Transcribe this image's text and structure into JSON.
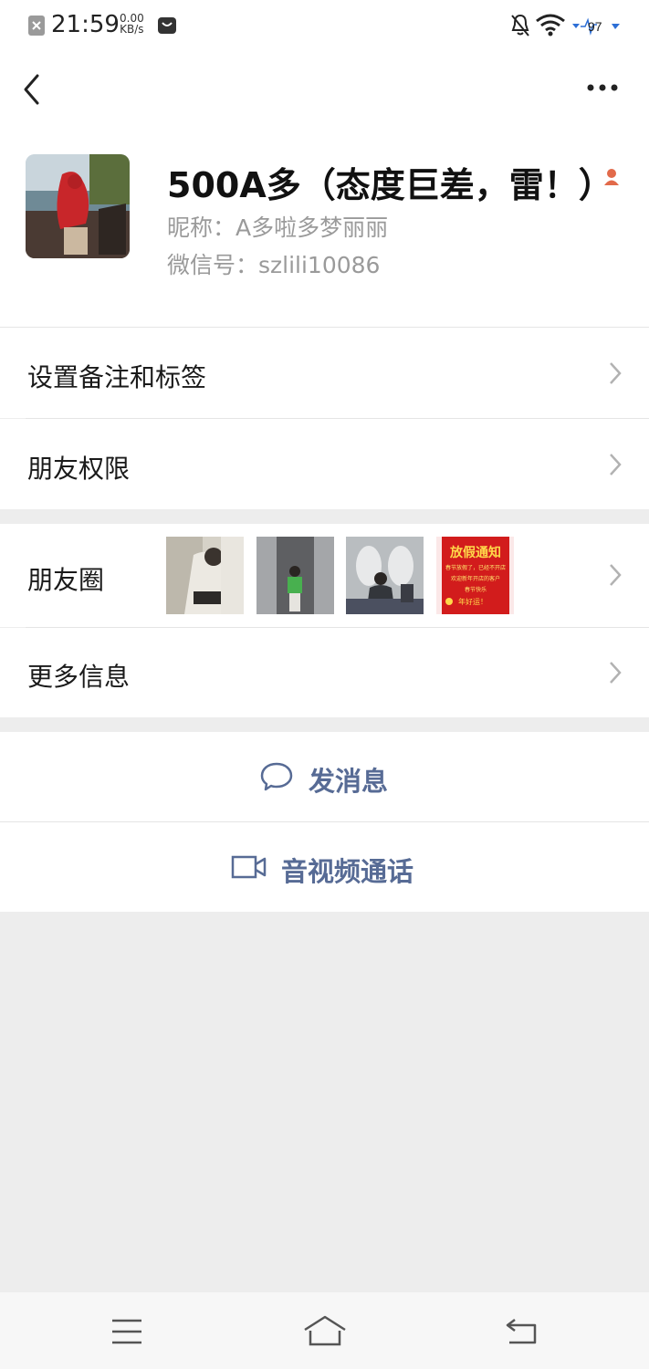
{
  "status_bar": {
    "time": "21:59",
    "net_speed_value": "0.00",
    "net_speed_unit": "KB/s",
    "battery": "97"
  },
  "profile": {
    "display_name": "500A多（态度巨差，雷！）",
    "nickname": "昵称：A多啦多梦丽丽",
    "wechat_id": "微信号：szlili10086"
  },
  "menu": {
    "remark_label": "设置备注和标签",
    "permission_label": "朋友权限",
    "moments_label": "朋友圈",
    "more_info_label": "更多信息"
  },
  "moments_thumb_text": {
    "title": "放假通知",
    "line1": "春节放假了，已经不开店",
    "line2": "欢迎新年开店的客户",
    "line3": "春节快乐",
    "line4": "年好运！"
  },
  "actions": {
    "send_message": "发消息",
    "video_call": "音视频通话"
  },
  "colors": {
    "link_blue": "#576b95",
    "background": "#ededed",
    "alert_red": "#e26a4a"
  }
}
